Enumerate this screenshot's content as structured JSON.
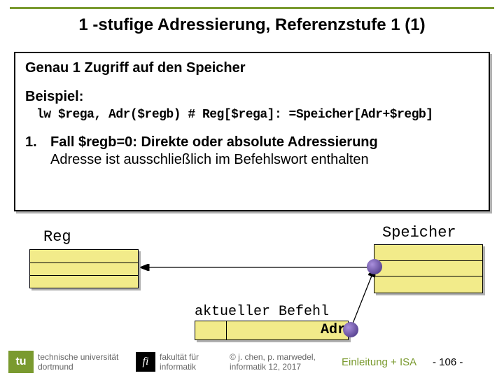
{
  "title": "1 -stufige Adressierung, Referenzstufe 1 (1)",
  "box": {
    "heading": "Genau 1 Zugriff auf den Speicher",
    "example_label": "Beispiel:",
    "code": "lw $rega, Adr($regb) # Reg[$rega]: =Speicher[Adr+$regb]",
    "case_num": "1.",
    "case_line1": "Fall $regb=0: Direkte oder absolute Adressierung",
    "case_line2": "Adresse ist ausschließlich im Befehlswort enthalten"
  },
  "labels": {
    "reg": "Reg",
    "speicher": "Speicher",
    "befehl": "aktueller Befehl",
    "adr": "Adr"
  },
  "footer": {
    "tu_abbr": "tu",
    "uni1": "technische universität",
    "uni2": "dortmund",
    "fi_abbr": "fi",
    "fak1": "fakultät für",
    "fak2": "informatik",
    "copy1": "© j. chen, p. marwedel,",
    "copy2": "informatik 12,  2017",
    "section": "Einleitung + ISA",
    "page": "-  106 -"
  }
}
